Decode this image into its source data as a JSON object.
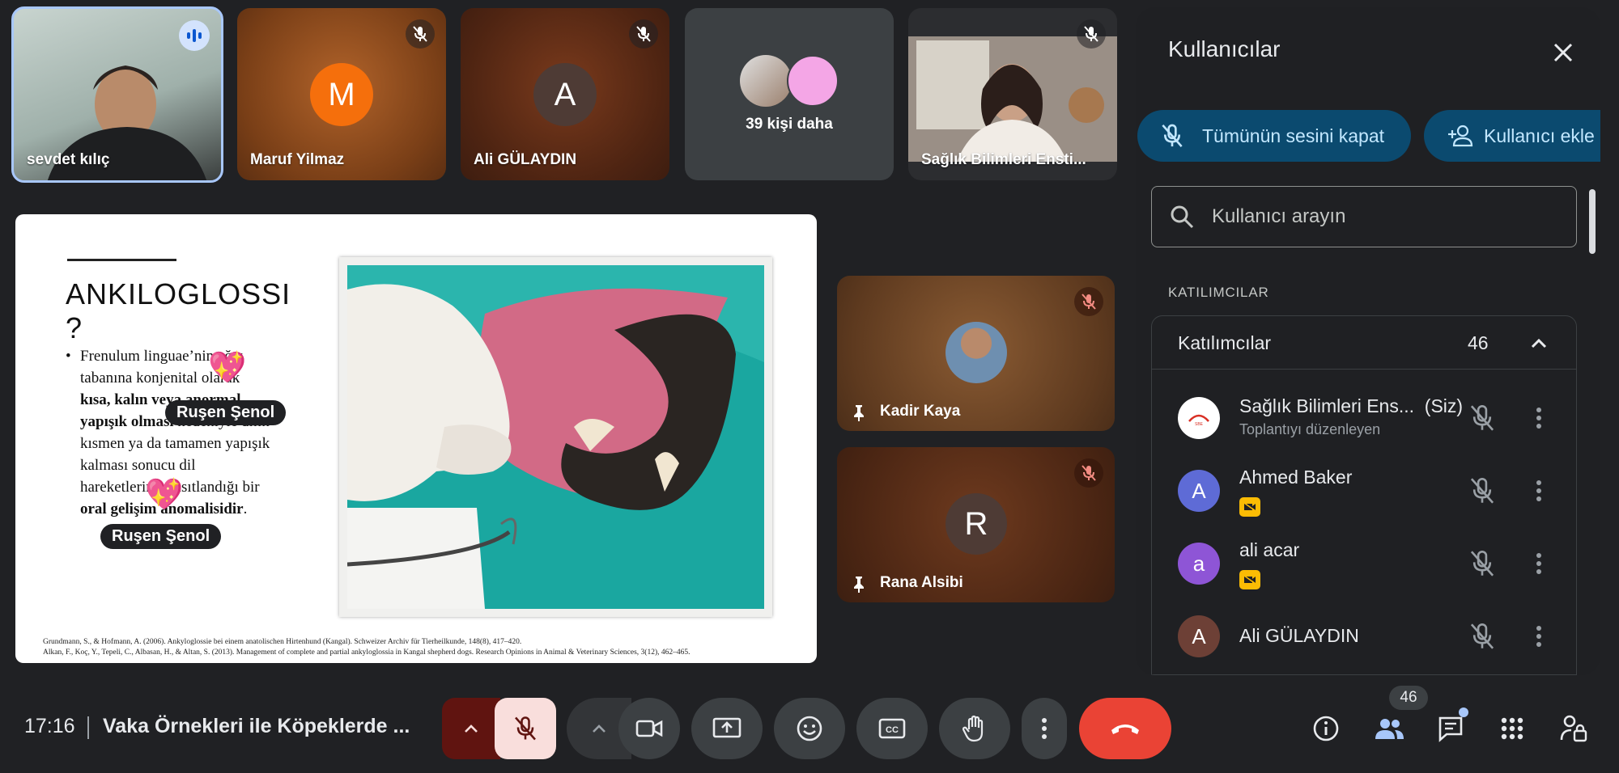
{
  "top_tiles": [
    {
      "name": "sevdet kılıç",
      "speaking": true
    },
    {
      "name": "Maruf Yilmaz",
      "initial": "M",
      "muted": true
    },
    {
      "name": "Ali GÜLAYDIN",
      "initial": "A",
      "muted": true
    },
    {
      "more_label": "39 kişi daha"
    },
    {
      "name": "Sağlık Bilimleri Ensti...",
      "muted": true
    }
  ],
  "side_tiles": [
    {
      "name": "Kadir Kaya",
      "muted": true,
      "pinned": true
    },
    {
      "name": "Rana Alsibi",
      "initial": "R",
      "muted": true,
      "pinned": true
    }
  ],
  "slide": {
    "title": "ANKILOGLOSSI ?",
    "body_lines": [
      {
        "text": "Frenulum linguae’nin ağız",
        "bold": false
      },
      {
        "text": "tabanına konjenital olarak",
        "bold": false
      },
      {
        "text": "kısa, kalın veya anormal",
        "bold": true
      },
      {
        "text": "yapışık olması nedeniyle dilin",
        "bold": "partial"
      },
      {
        "text": "kısmen ya da tamamen yapışık",
        "bold": false
      },
      {
        "text": "kalması sonucu dil",
        "bold": false
      },
      {
        "text": "hareketlerinin kısıtlandığı bir",
        "bold": false
      },
      {
        "text": "oral gelişim anomalisidir.",
        "bold": "partial"
      }
    ],
    "body_bold_prefix_line4": "yapışık olması",
    "body_rest_line4": " nedeniyle dilin",
    "body_bold_line8": "oral gelişim anomalisidir",
    "body_end_line8": ".",
    "reference_1": "Grundmann, S., & Hofmann, A. (2006). Ankyloglossie bei einem anatolischen Hirtenhund (Kangal). Schweizer Archiv für Tierheilkunde, 148(8), 417–420.",
    "reference_2": "Alkan, F., Koç, Y., Tepeli, C., Albasan, H., & Altan, S. (2013). Management of complete and partial ankyloglossia in Kangal shepherd dogs. Research Opinions in Animal & Veterinary Sciences, 3(12), 462–465.",
    "reaction_name": "Ruşen Şenol"
  },
  "panel": {
    "title": "Kullanıcılar",
    "mute_all_label": "Tümünün sesini kapat",
    "add_user_label": "Kullanıcı ekle",
    "search_placeholder": "Kullanıcı arayın",
    "section_label": "KATILIMCILAR",
    "group_title": "Katılımcılar",
    "group_count": "46",
    "participants": [
      {
        "name": "Sağlık Bilimleri Ens...",
        "suffix": "(Siz)",
        "subtitle": "Toplantıyı düzenleyen",
        "avatar_color": "#ffffff"
      },
      {
        "name": "Ahmed Baker",
        "initial": "A",
        "avatar_color": "#5e6bd6",
        "badge": true
      },
      {
        "name": "ali acar",
        "initial": "a",
        "avatar_color": "#8e55d6",
        "badge": true
      },
      {
        "name": "Ali GÜLAYDIN",
        "initial": "A",
        "avatar_color": "#6d4036"
      }
    ]
  },
  "bottom_bar": {
    "time": "17:16",
    "meeting_title": "Vaka Örnekleri ile Köpeklerde ...",
    "people_count": "46"
  },
  "colors": {
    "background": "#202124",
    "end_call_red": "#ea4335",
    "mic_off_red": "#f9dedc",
    "accent_blue": "#0b4a6f",
    "accent_text": "#c2e7ff",
    "people_icon_blue": "#a8c7fa"
  }
}
